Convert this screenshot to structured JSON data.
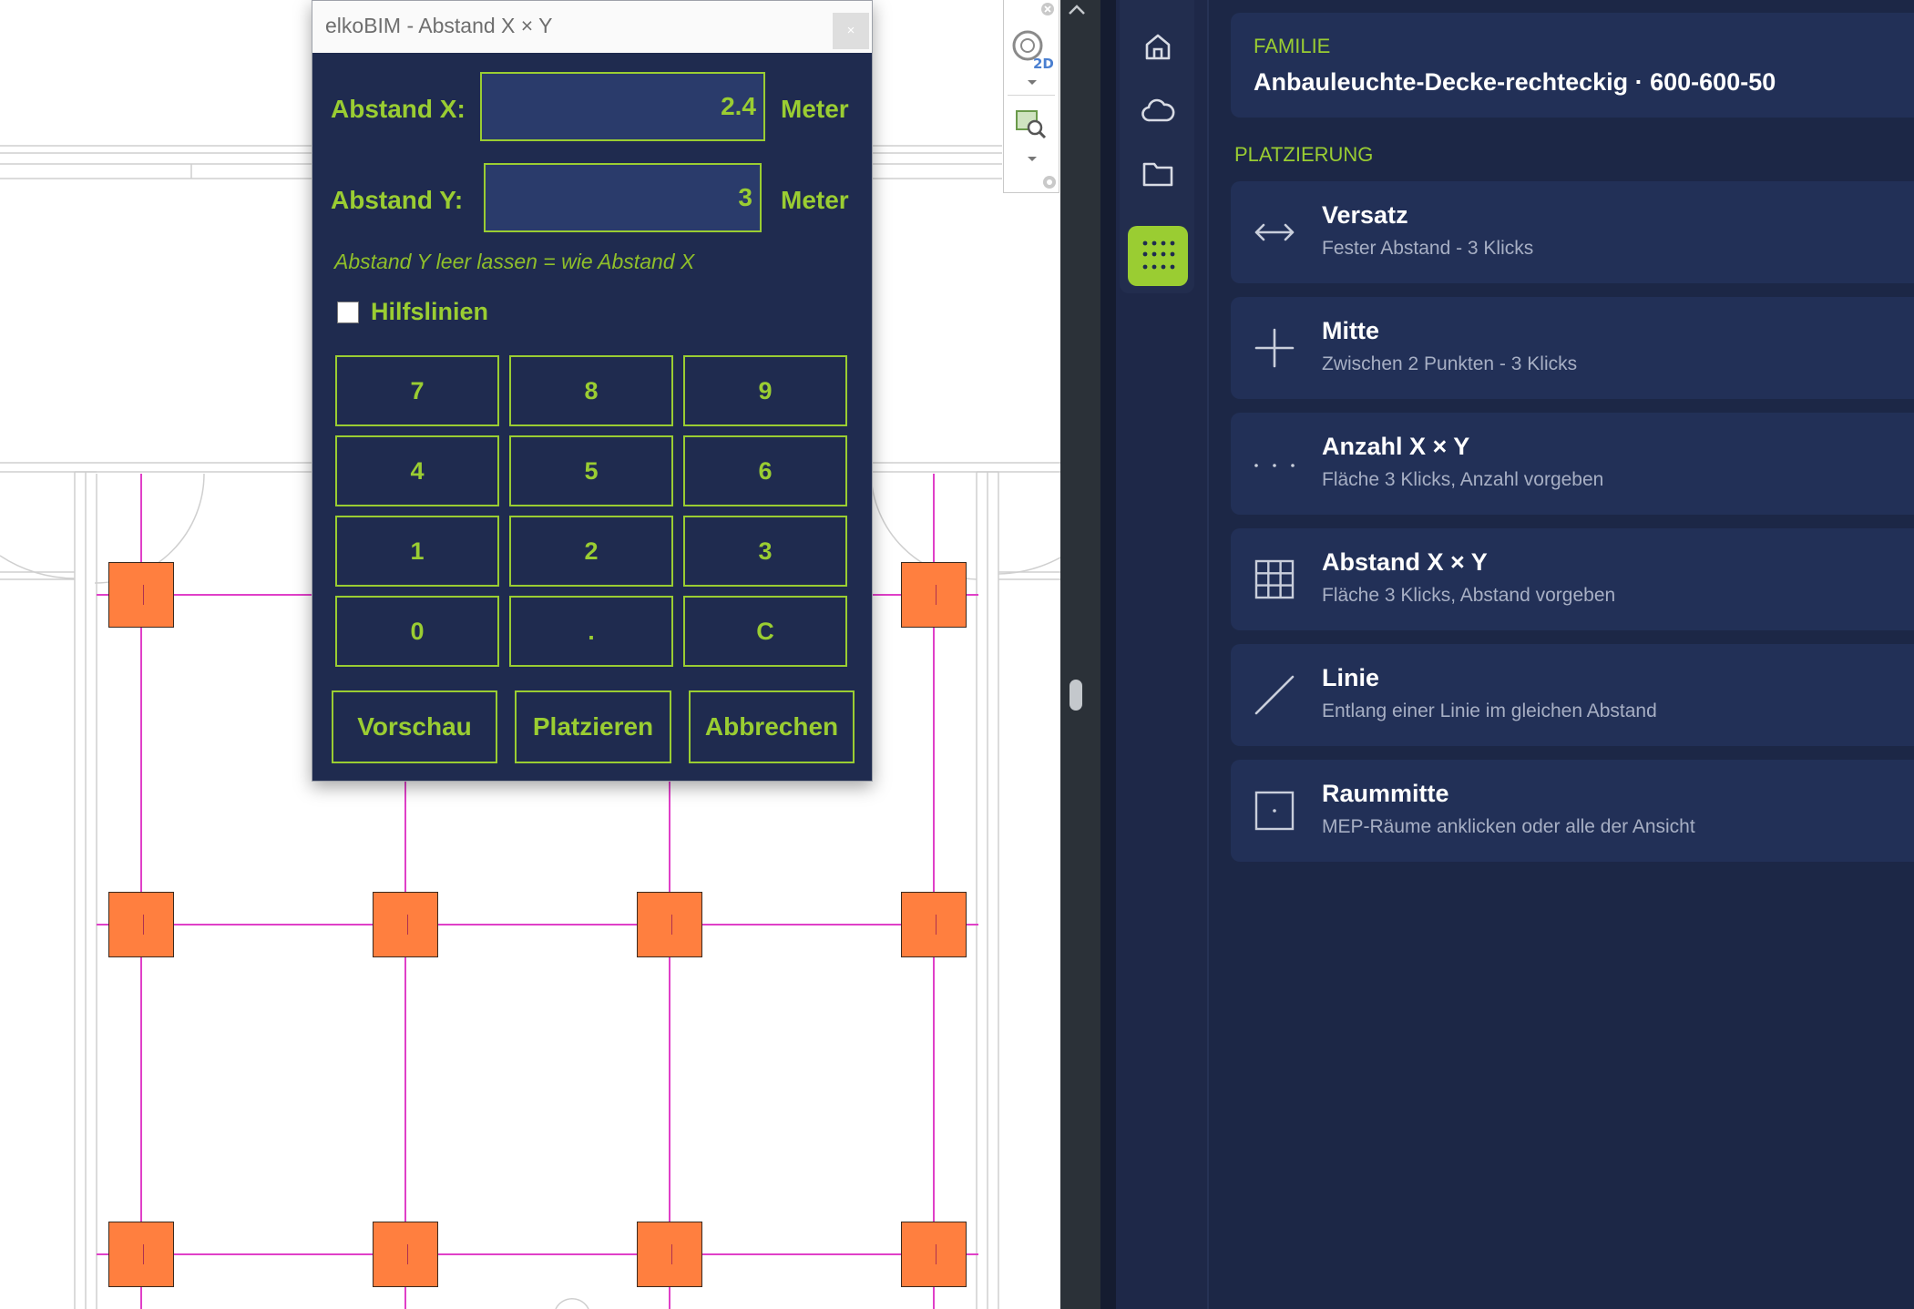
{
  "dialog": {
    "title": "elkoBIM - Abstand X × Y",
    "close_label": "×",
    "abstand_x_label": "Abstand X:",
    "abstand_x_value": "2.4",
    "abstand_x_unit": "Meter",
    "abstand_y_label": "Abstand Y:",
    "abstand_y_value": "3",
    "abstand_y_unit": "Meter",
    "hint": "Abstand Y leer lassen = wie Abstand X",
    "hilfslinien_label": "Hilfslinien",
    "hilfslinien_checked": false,
    "keypad": [
      "7",
      "8",
      "9",
      "4",
      "5",
      "6",
      "1",
      "2",
      "3",
      "0",
      ".",
      "C"
    ],
    "preview_label": "Vorschau",
    "place_label": "Platzieren",
    "cancel_label": "Abbrechen"
  },
  "sidebar": {
    "family_heading": "FAMILIE",
    "family_value": "Anbauleuchte-Decke-rechteckig · 600-600-50",
    "placement_heading": "PLATZIERUNG",
    "modes": [
      {
        "title": "Versatz",
        "subtitle": "Fester Abstand - 3 Klicks",
        "icon": "double-arrow-icon"
      },
      {
        "title": "Mitte",
        "subtitle": "Zwischen 2 Punkten - 3 Klicks",
        "icon": "plus-icon"
      },
      {
        "title": "Anzahl X × Y",
        "subtitle": "Fläche 3 Klicks, Anzahl vorgeben",
        "icon": "dots-icon"
      },
      {
        "title": "Abstand X × Y",
        "subtitle": "Fläche 3 Klicks, Abstand vorgeben",
        "icon": "grid-icon"
      },
      {
        "title": "Linie",
        "subtitle": "Entlang einer Linie im gleichen Abstand",
        "icon": "diagonal-line-icon"
      },
      {
        "title": "Raummitte",
        "subtitle": "MEP-Räume anklicken oder alle der Ansicht",
        "icon": "square-dot-icon"
      }
    ]
  },
  "rail": {
    "items": [
      "home-icon",
      "cloud-icon",
      "folder-icon",
      "grid-dots-icon"
    ],
    "active": "grid-dots-icon"
  },
  "colors": {
    "accent": "#9ACD32",
    "dialog_bg": "#1F2B4F",
    "panel_bg": "#1C2746",
    "card_bg": "#223057",
    "fixture": "#FF7F3F",
    "guide_line": "#e040c8"
  }
}
